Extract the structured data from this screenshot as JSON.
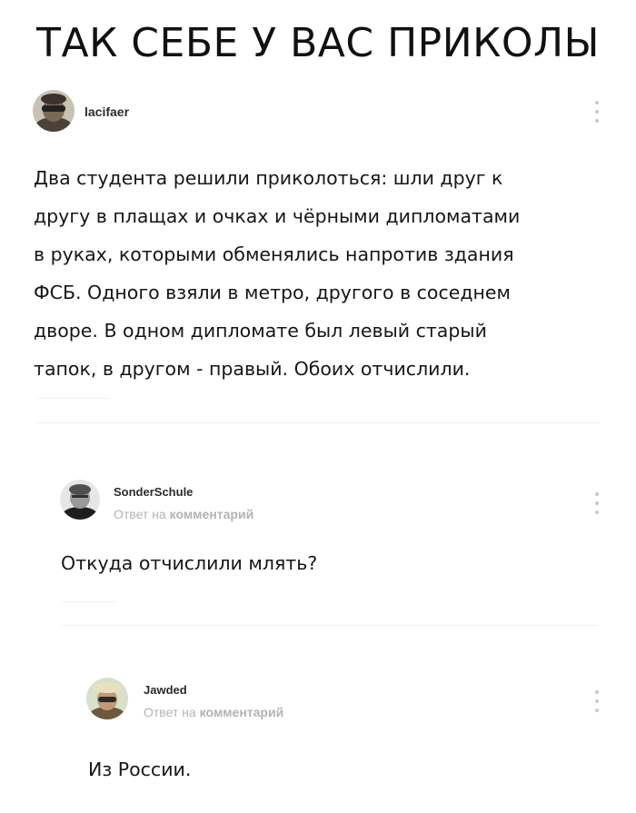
{
  "title": "ТАК СЕБЕ У ВАС ПРИКОЛЫ",
  "comments": [
    {
      "username": "lacifaer",
      "avatar_icon": "user-avatar-icon",
      "menu_icon": "more-vertical-icon",
      "text": "Два студента решили приколоться: шли друг к\nдругу в плащах и очках и чёрными дипломатами\nв руках, которыми обменялись напротив здания\nФСБ. Одного взяли в метро, другого в соседнем\nдворе. В одном дипломате был левый старый\nтапок, в другом - правый. Обоих отчислили."
    },
    {
      "username": "SonderSchule",
      "reply_prefix": "Ответ на",
      "reply_target": "комментарий",
      "avatar_icon": "user-avatar-icon",
      "menu_icon": "more-vertical-icon",
      "text": "Откуда отчислили млять?"
    },
    {
      "username": "Jawded",
      "reply_prefix": "Ответ на",
      "reply_target": "комментарий",
      "avatar_icon": "user-avatar-icon",
      "menu_icon": "more-vertical-icon",
      "text": "Из России."
    }
  ],
  "colors": {
    "text": "#161616",
    "muted": "#b3b3b3",
    "dots": "#c9c9c9"
  }
}
